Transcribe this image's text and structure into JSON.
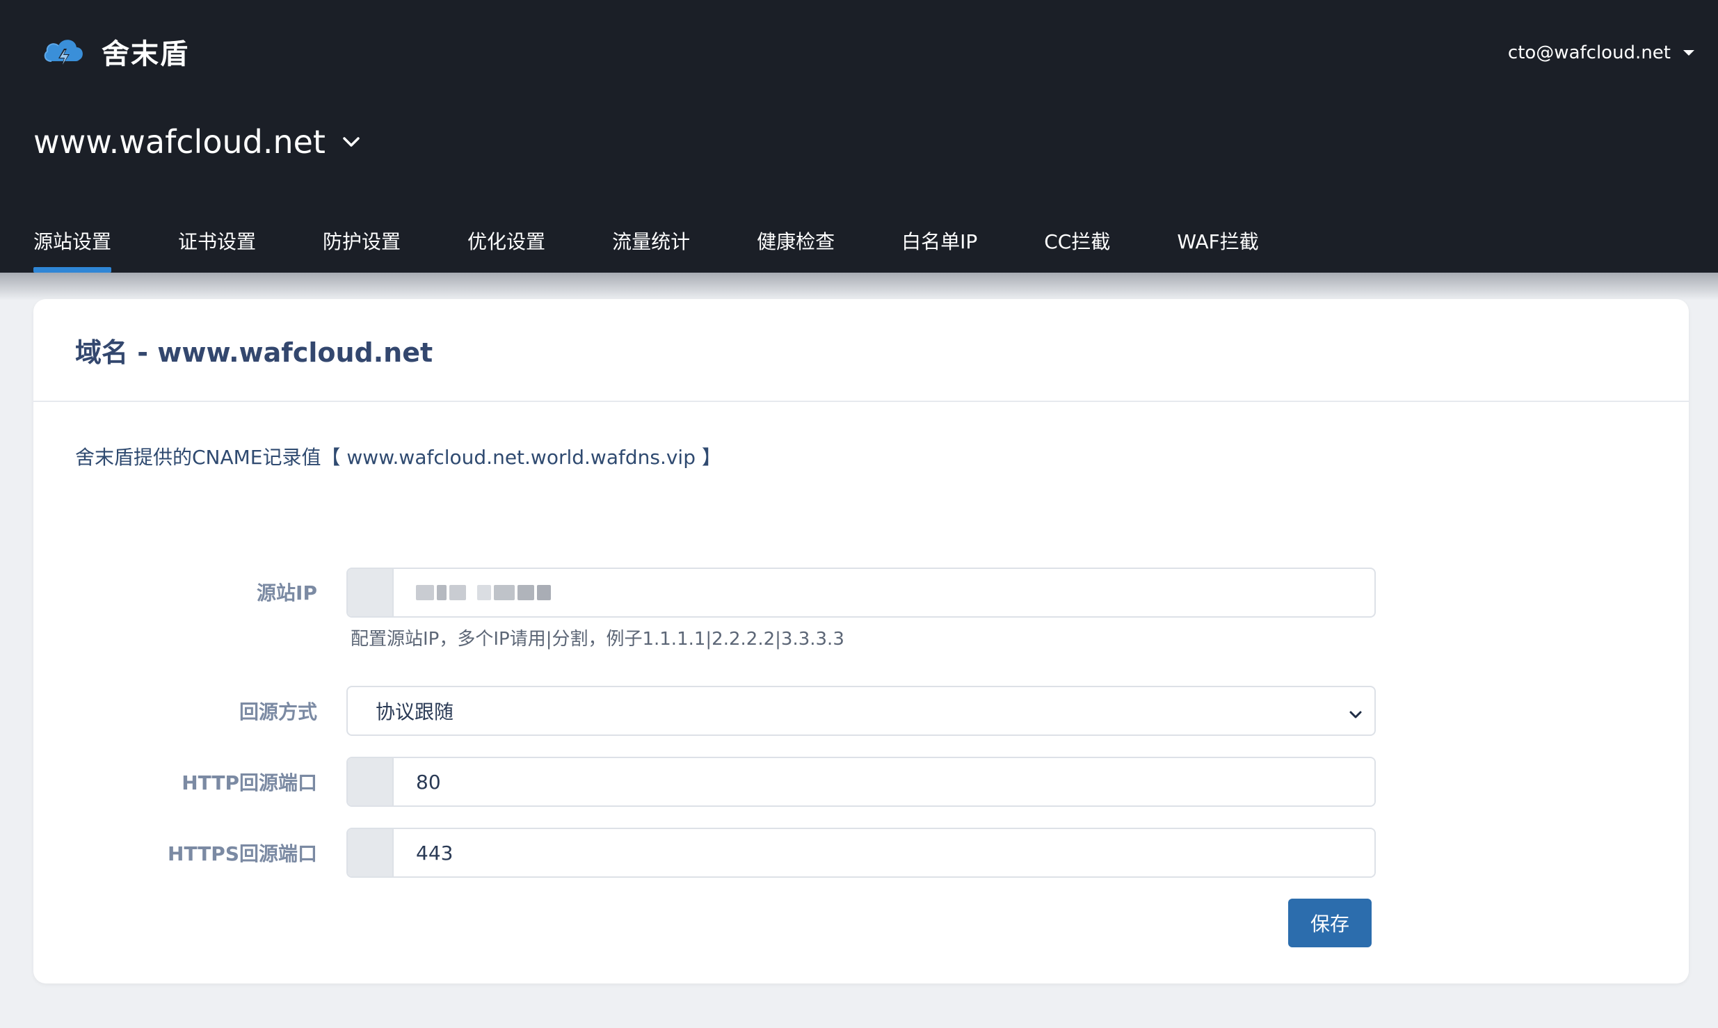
{
  "header": {
    "brand_name": "舍末盾",
    "user_email": "cto@wafcloud.net",
    "current_domain": "www.wafcloud.net"
  },
  "nav": {
    "tabs": [
      {
        "label": "源站设置",
        "active": true
      },
      {
        "label": "证书设置",
        "active": false
      },
      {
        "label": "防护设置",
        "active": false
      },
      {
        "label": "优化设置",
        "active": false
      },
      {
        "label": "流量统计",
        "active": false
      },
      {
        "label": "健康检查",
        "active": false
      },
      {
        "label": "白名单IP",
        "active": false
      },
      {
        "label": "CC拦截",
        "active": false
      },
      {
        "label": "WAF拦截",
        "active": false
      }
    ]
  },
  "card": {
    "title": "域名 - www.wafcloud.net",
    "cname_text": "舍末盾提供的CNAME记录值【 www.wafcloud.net.world.wafdns.vip 】"
  },
  "form": {
    "origin_ip": {
      "label": "源站IP",
      "help": "配置源站IP，多个IP请用|分割，例子1.1.1.1|2.2.2.2|3.3.3.3"
    },
    "origin_protocol": {
      "label": "回源方式",
      "selected": "协议跟随"
    },
    "http_port": {
      "label": "HTTP回源端口",
      "value": "80"
    },
    "https_port": {
      "label": "HTTPS回源端口",
      "value": "443"
    },
    "save_label": "保存"
  },
  "colors": {
    "header_bg": "#1b1f27",
    "accent": "#2f86d6",
    "primary_button": "#2c6dad",
    "title_text": "#33476e"
  }
}
